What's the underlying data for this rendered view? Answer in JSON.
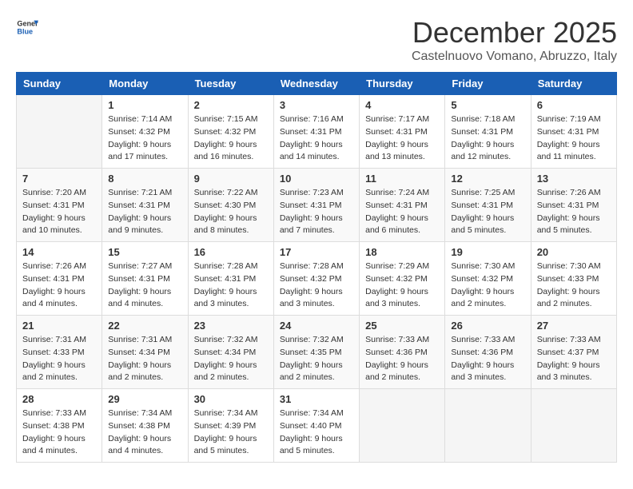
{
  "logo": {
    "line1": "General",
    "line2": "Blue"
  },
  "header": {
    "month": "December 2025",
    "location": "Castelnuovo Vomano, Abruzzo, Italy"
  },
  "weekdays": [
    "Sunday",
    "Monday",
    "Tuesday",
    "Wednesday",
    "Thursday",
    "Friday",
    "Saturday"
  ],
  "weeks": [
    [
      {
        "day": "",
        "sunrise": "",
        "sunset": "",
        "daylight": ""
      },
      {
        "day": "1",
        "sunrise": "Sunrise: 7:14 AM",
        "sunset": "Sunset: 4:32 PM",
        "daylight": "Daylight: 9 hours and 17 minutes."
      },
      {
        "day": "2",
        "sunrise": "Sunrise: 7:15 AM",
        "sunset": "Sunset: 4:32 PM",
        "daylight": "Daylight: 9 hours and 16 minutes."
      },
      {
        "day": "3",
        "sunrise": "Sunrise: 7:16 AM",
        "sunset": "Sunset: 4:31 PM",
        "daylight": "Daylight: 9 hours and 14 minutes."
      },
      {
        "day": "4",
        "sunrise": "Sunrise: 7:17 AM",
        "sunset": "Sunset: 4:31 PM",
        "daylight": "Daylight: 9 hours and 13 minutes."
      },
      {
        "day": "5",
        "sunrise": "Sunrise: 7:18 AM",
        "sunset": "Sunset: 4:31 PM",
        "daylight": "Daylight: 9 hours and 12 minutes."
      },
      {
        "day": "6",
        "sunrise": "Sunrise: 7:19 AM",
        "sunset": "Sunset: 4:31 PM",
        "daylight": "Daylight: 9 hours and 11 minutes."
      }
    ],
    [
      {
        "day": "7",
        "sunrise": "Sunrise: 7:20 AM",
        "sunset": "Sunset: 4:31 PM",
        "daylight": "Daylight: 9 hours and 10 minutes."
      },
      {
        "day": "8",
        "sunrise": "Sunrise: 7:21 AM",
        "sunset": "Sunset: 4:31 PM",
        "daylight": "Daylight: 9 hours and 9 minutes."
      },
      {
        "day": "9",
        "sunrise": "Sunrise: 7:22 AM",
        "sunset": "Sunset: 4:30 PM",
        "daylight": "Daylight: 9 hours and 8 minutes."
      },
      {
        "day": "10",
        "sunrise": "Sunrise: 7:23 AM",
        "sunset": "Sunset: 4:31 PM",
        "daylight": "Daylight: 9 hours and 7 minutes."
      },
      {
        "day": "11",
        "sunrise": "Sunrise: 7:24 AM",
        "sunset": "Sunset: 4:31 PM",
        "daylight": "Daylight: 9 hours and 6 minutes."
      },
      {
        "day": "12",
        "sunrise": "Sunrise: 7:25 AM",
        "sunset": "Sunset: 4:31 PM",
        "daylight": "Daylight: 9 hours and 5 minutes."
      },
      {
        "day": "13",
        "sunrise": "Sunrise: 7:26 AM",
        "sunset": "Sunset: 4:31 PM",
        "daylight": "Daylight: 9 hours and 5 minutes."
      }
    ],
    [
      {
        "day": "14",
        "sunrise": "Sunrise: 7:26 AM",
        "sunset": "Sunset: 4:31 PM",
        "daylight": "Daylight: 9 hours and 4 minutes."
      },
      {
        "day": "15",
        "sunrise": "Sunrise: 7:27 AM",
        "sunset": "Sunset: 4:31 PM",
        "daylight": "Daylight: 9 hours and 4 minutes."
      },
      {
        "day": "16",
        "sunrise": "Sunrise: 7:28 AM",
        "sunset": "Sunset: 4:31 PM",
        "daylight": "Daylight: 9 hours and 3 minutes."
      },
      {
        "day": "17",
        "sunrise": "Sunrise: 7:28 AM",
        "sunset": "Sunset: 4:32 PM",
        "daylight": "Daylight: 9 hours and 3 minutes."
      },
      {
        "day": "18",
        "sunrise": "Sunrise: 7:29 AM",
        "sunset": "Sunset: 4:32 PM",
        "daylight": "Daylight: 9 hours and 3 minutes."
      },
      {
        "day": "19",
        "sunrise": "Sunrise: 7:30 AM",
        "sunset": "Sunset: 4:32 PM",
        "daylight": "Daylight: 9 hours and 2 minutes."
      },
      {
        "day": "20",
        "sunrise": "Sunrise: 7:30 AM",
        "sunset": "Sunset: 4:33 PM",
        "daylight": "Daylight: 9 hours and 2 minutes."
      }
    ],
    [
      {
        "day": "21",
        "sunrise": "Sunrise: 7:31 AM",
        "sunset": "Sunset: 4:33 PM",
        "daylight": "Daylight: 9 hours and 2 minutes."
      },
      {
        "day": "22",
        "sunrise": "Sunrise: 7:31 AM",
        "sunset": "Sunset: 4:34 PM",
        "daylight": "Daylight: 9 hours and 2 minutes."
      },
      {
        "day": "23",
        "sunrise": "Sunrise: 7:32 AM",
        "sunset": "Sunset: 4:34 PM",
        "daylight": "Daylight: 9 hours and 2 minutes."
      },
      {
        "day": "24",
        "sunrise": "Sunrise: 7:32 AM",
        "sunset": "Sunset: 4:35 PM",
        "daylight": "Daylight: 9 hours and 2 minutes."
      },
      {
        "day": "25",
        "sunrise": "Sunrise: 7:33 AM",
        "sunset": "Sunset: 4:36 PM",
        "daylight": "Daylight: 9 hours and 2 minutes."
      },
      {
        "day": "26",
        "sunrise": "Sunrise: 7:33 AM",
        "sunset": "Sunset: 4:36 PM",
        "daylight": "Daylight: 9 hours and 3 minutes."
      },
      {
        "day": "27",
        "sunrise": "Sunrise: 7:33 AM",
        "sunset": "Sunset: 4:37 PM",
        "daylight": "Daylight: 9 hours and 3 minutes."
      }
    ],
    [
      {
        "day": "28",
        "sunrise": "Sunrise: 7:33 AM",
        "sunset": "Sunset: 4:38 PM",
        "daylight": "Daylight: 9 hours and 4 minutes."
      },
      {
        "day": "29",
        "sunrise": "Sunrise: 7:34 AM",
        "sunset": "Sunset: 4:38 PM",
        "daylight": "Daylight: 9 hours and 4 minutes."
      },
      {
        "day": "30",
        "sunrise": "Sunrise: 7:34 AM",
        "sunset": "Sunset: 4:39 PM",
        "daylight": "Daylight: 9 hours and 5 minutes."
      },
      {
        "day": "31",
        "sunrise": "Sunrise: 7:34 AM",
        "sunset": "Sunset: 4:40 PM",
        "daylight": "Daylight: 9 hours and 5 minutes."
      },
      {
        "day": "",
        "sunrise": "",
        "sunset": "",
        "daylight": ""
      },
      {
        "day": "",
        "sunrise": "",
        "sunset": "",
        "daylight": ""
      },
      {
        "day": "",
        "sunrise": "",
        "sunset": "",
        "daylight": ""
      }
    ]
  ]
}
